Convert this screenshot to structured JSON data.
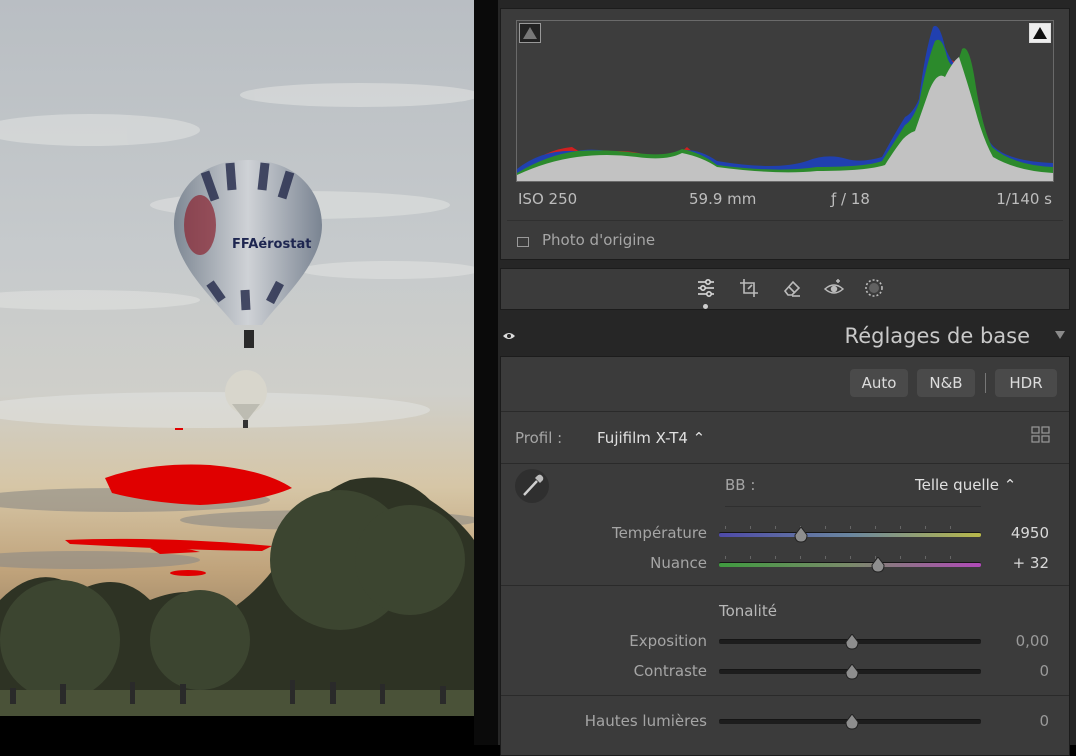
{
  "histogram": {
    "iso": "ISO 250",
    "focal_length": "59.9 mm",
    "aperture": "ƒ / 18",
    "shutter": "1/140 s",
    "show_original_label": "Photo d'origine"
  },
  "section": {
    "title": "Réglages de base"
  },
  "treatment_buttons": {
    "auto": "Auto",
    "bw": "N&B",
    "hdr": "HDR"
  },
  "profile": {
    "label": "Profil :",
    "value": "Fujifilm X-T4 ⌃"
  },
  "white_balance": {
    "label": "BB :",
    "value": "Telle quelle ⌃"
  },
  "sliders_wb": [
    {
      "label": "Température",
      "value": "4950",
      "position": 0.31
    },
    {
      "label": "Nuance",
      "value": "+ 32",
      "position": 0.6
    }
  ],
  "tone": {
    "heading": "Tonalité",
    "sliders": [
      {
        "label": "Exposition",
        "value": "0,00",
        "position": 0.5
      },
      {
        "label": "Contraste",
        "value": "0",
        "position": 0.5
      },
      {
        "label": "Hautes lumières",
        "value": "0",
        "position": 0.5
      }
    ]
  },
  "colors": {
    "clip_highlight": "#e00000",
    "panel_bg": "#3b3b3b"
  },
  "tools": [
    "edit-sliders-icon",
    "crop-icon",
    "heal-eraser-icon",
    "redeye-icon",
    "mask-icon"
  ]
}
